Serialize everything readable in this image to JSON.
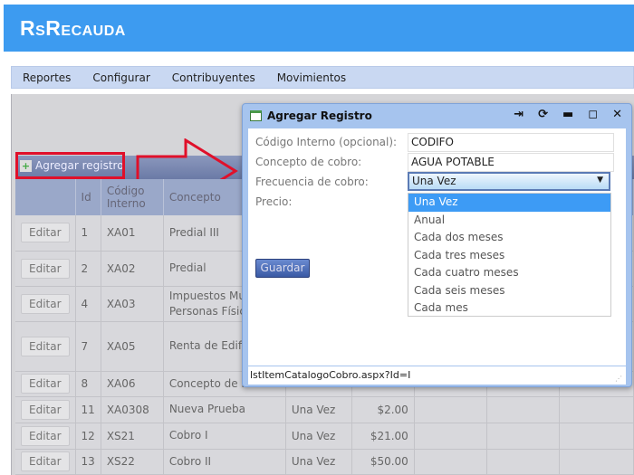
{
  "app": {
    "title": "RsRecauda"
  },
  "nav": {
    "items": [
      "Reportes",
      "Configurar",
      "Contribuyentes",
      "Movimientos"
    ]
  },
  "toolbar": {
    "add_label": "Agregar registro"
  },
  "table": {
    "headers": [
      "",
      "Id",
      "Código Interno",
      "Concepto",
      "",
      "",
      "",
      "",
      ""
    ],
    "rows": [
      {
        "edit": "Editar",
        "id": "1",
        "code": "XA01",
        "concept": "Predial III",
        "freq": "",
        "price": ""
      },
      {
        "edit": "Editar",
        "id": "2",
        "code": "XA02",
        "concept": "Predial",
        "freq": "",
        "price": ""
      },
      {
        "edit": "Editar",
        "id": "4",
        "code": "XA03",
        "concept": "Impuestos Mun a Personas Físic",
        "freq": "",
        "price": ""
      },
      {
        "edit": "Editar",
        "id": "7",
        "code": "XA05",
        "concept": "Renta de Edifici",
        "freq": "",
        "price": ""
      },
      {
        "edit": "Editar",
        "id": "8",
        "code": "XA06",
        "concept": "Concepto de Pr",
        "freq": "",
        "price": ""
      },
      {
        "edit": "Editar",
        "id": "11",
        "code": "XA0308",
        "concept": "Nueva Prueba",
        "freq": "Una Vez",
        "price": "$2.00"
      },
      {
        "edit": "Editar",
        "id": "12",
        "code": "XS21",
        "concept": "Cobro I",
        "freq": "Una Vez",
        "price": "$21.00"
      },
      {
        "edit": "Editar",
        "id": "13",
        "code": "XS22",
        "concept": "Cobro II",
        "freq": "Una Vez",
        "price": "$50.00"
      }
    ]
  },
  "dialog": {
    "title": "Agregar Registro",
    "controls": [
      "⇥",
      "⟳",
      "▬",
      "◻",
      "✕"
    ],
    "labels": {
      "code": "Código Interno (opcional):",
      "concept": "Concepto de cobro:",
      "freq": "Frecuencia de cobro:",
      "price": "Precio:"
    },
    "values": {
      "code": "CODIFO",
      "concept": "AGUA POTABLE",
      "freq": "Una Vez"
    },
    "options": [
      "Una Vez",
      "Anual",
      "Cada dos meses",
      "Cada tres meses",
      "Cada cuatro meses",
      "Cada seis meses",
      "Cada mes"
    ],
    "save_label": "Guardar",
    "status": "lstItemCatalogoCobro.aspx?Id=I"
  },
  "colors": {
    "header": "#3d9bf0",
    "annotation": "#e0102a",
    "selected": "#3d9bf5"
  }
}
